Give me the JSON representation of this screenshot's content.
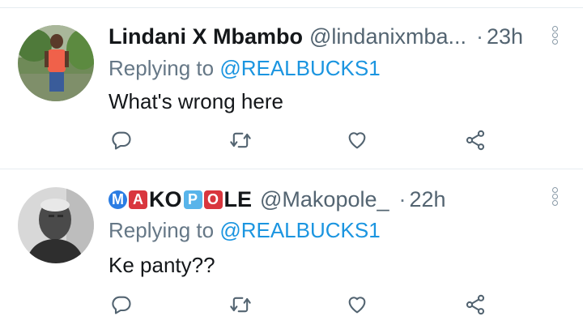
{
  "tweets": [
    {
      "name": "Lindani X Mbambo",
      "handle": "@lindanixmba...",
      "separator": "·",
      "time": "23h",
      "replying_prefix": "Replying to",
      "replying_to": "@REALBUCKS1",
      "text": "What's wrong here"
    },
    {
      "name_parts": [
        "M",
        "A",
        "KO",
        "P",
        "O",
        "LE"
      ],
      "handle": "@Makopole_",
      "separator": "·",
      "time": "22h",
      "replying_prefix": "Replying to",
      "replying_to": "@REALBUCKS1",
      "text": "Ke panty??"
    }
  ],
  "icons": [
    "reply-icon",
    "retweet-icon",
    "like-icon",
    "share-icon",
    "more-options-icon"
  ],
  "colors": {
    "mention": "#1b95e0",
    "secondary_text": "#657786",
    "icon": "#536471",
    "divider": "#e6ecf0"
  }
}
